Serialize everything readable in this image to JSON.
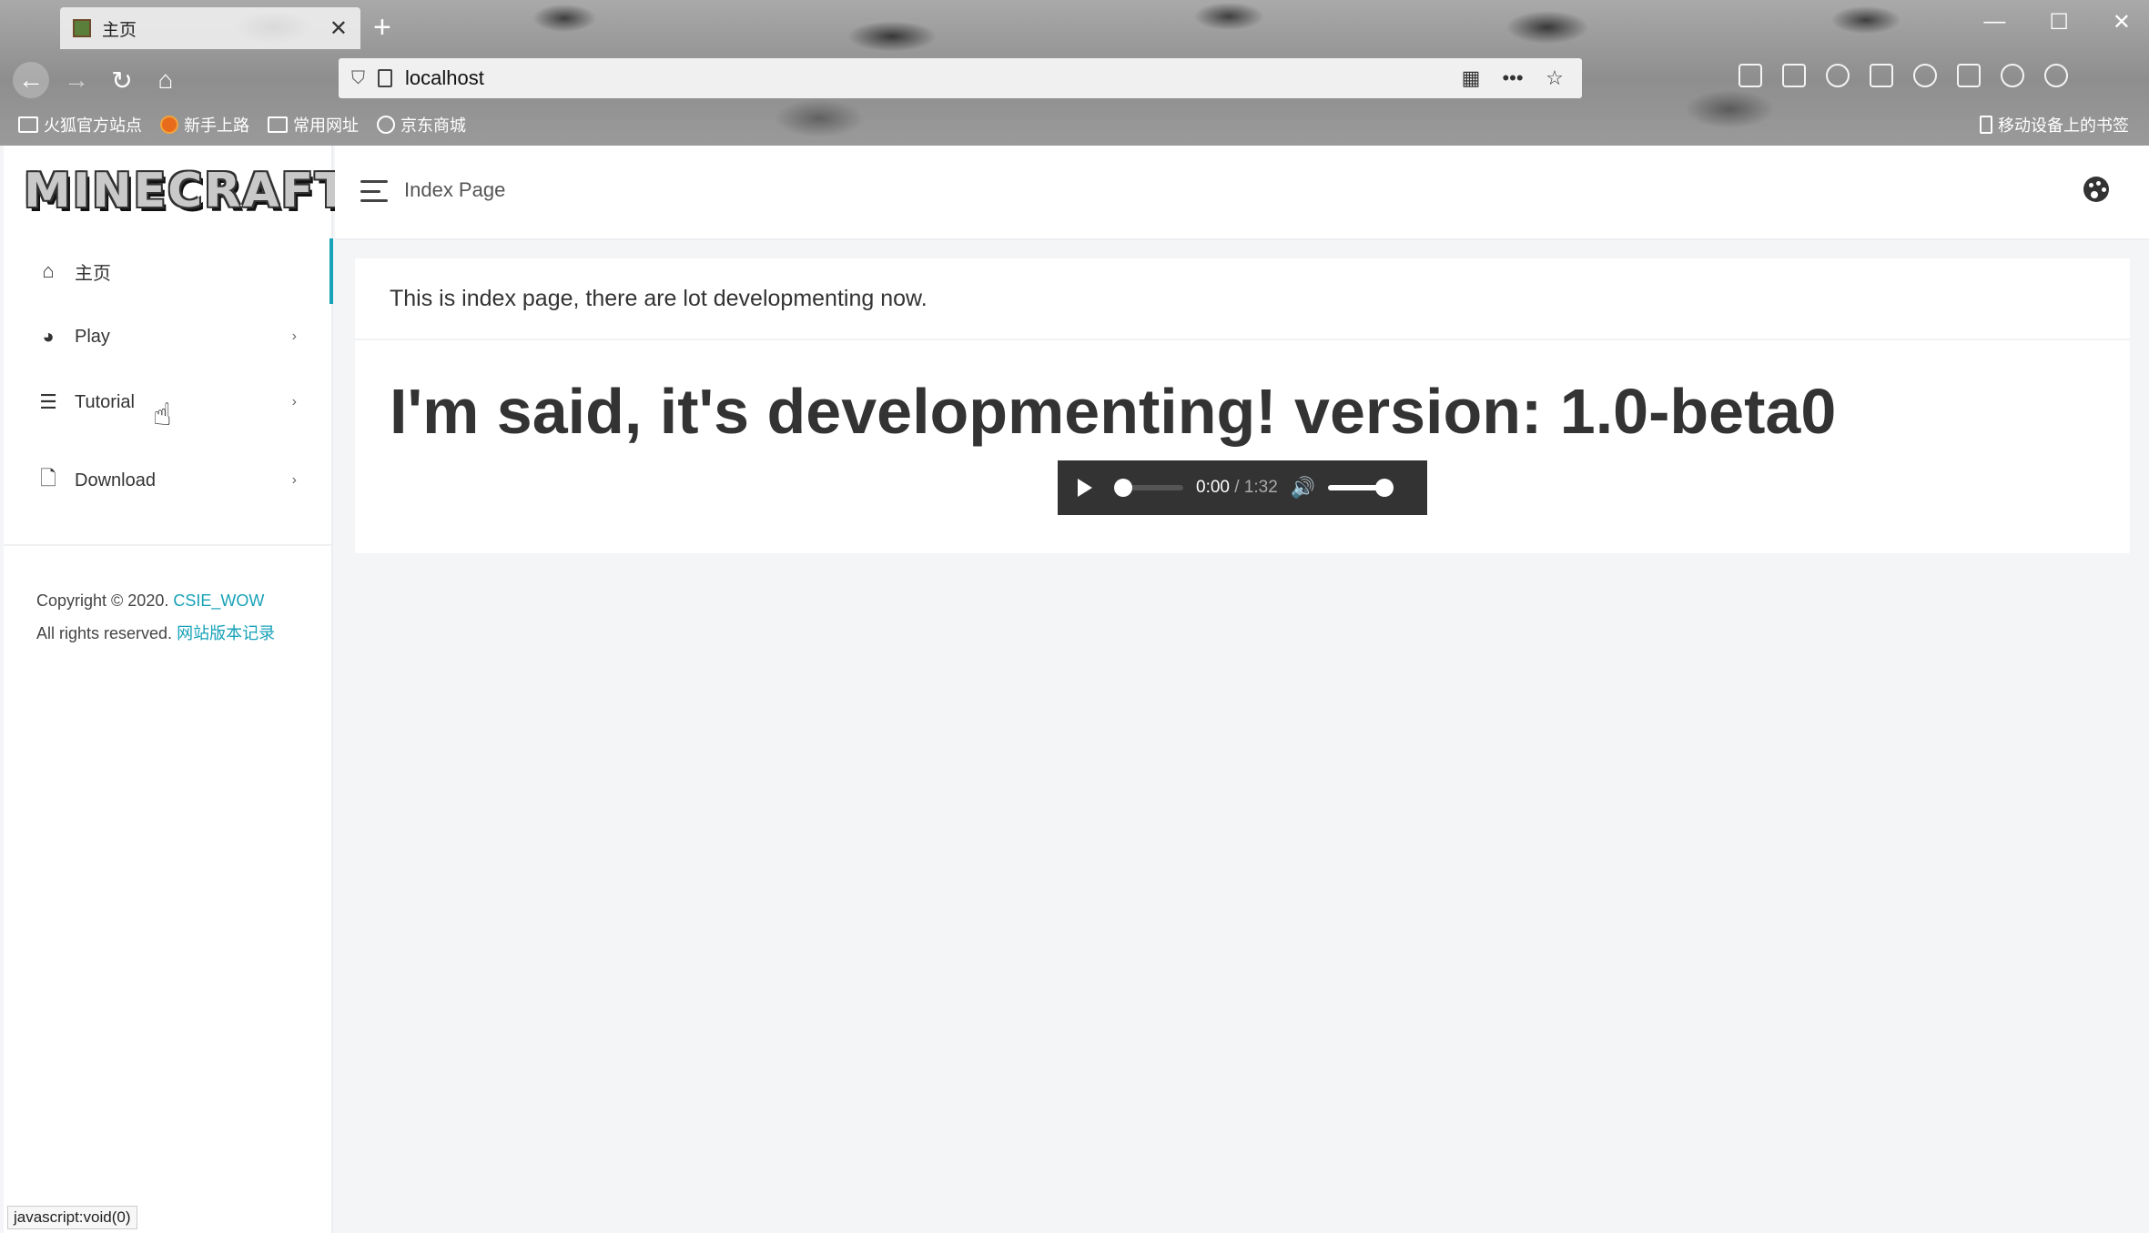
{
  "browser": {
    "tab_title": "主页",
    "url": "localhost",
    "bookmarks": [
      "火狐官方站点",
      "新手上路",
      "常用网址",
      "京东商城"
    ],
    "mobile_bookmarks": "移动设备上的书签",
    "status_text": "javascript:void(0)"
  },
  "sidebar": {
    "logo_text": "MINECRAFT",
    "items": [
      {
        "label": "主页",
        "icon": "home-icon",
        "active": true
      },
      {
        "label": "Play",
        "icon": "palette-icon"
      },
      {
        "label": "Tutorial",
        "icon": "list-icon"
      },
      {
        "label": "Download",
        "icon": "file-icon"
      }
    ],
    "copyright_line1": "Copyright © 2020.",
    "copyright_link": "CSIE_WOW",
    "copyright_line2": "All rights reserved.",
    "version_link": "网站版本记录"
  },
  "header": {
    "breadcrumb": "Index Page",
    "theme_icon": "palette-icon"
  },
  "main": {
    "card_header": "This is index page, there are lot developmenting now.",
    "headline": "I'm said, it's developmenting! version: 1.0-beta0",
    "audio": {
      "current_time": "0:00",
      "separator": "/",
      "duration": "1:32",
      "progress": 0.0,
      "volume": 1.0
    }
  },
  "colors": {
    "accent": "#17a2b8",
    "audio_bg": "#333333",
    "page_bg": "#f4f5f7"
  }
}
